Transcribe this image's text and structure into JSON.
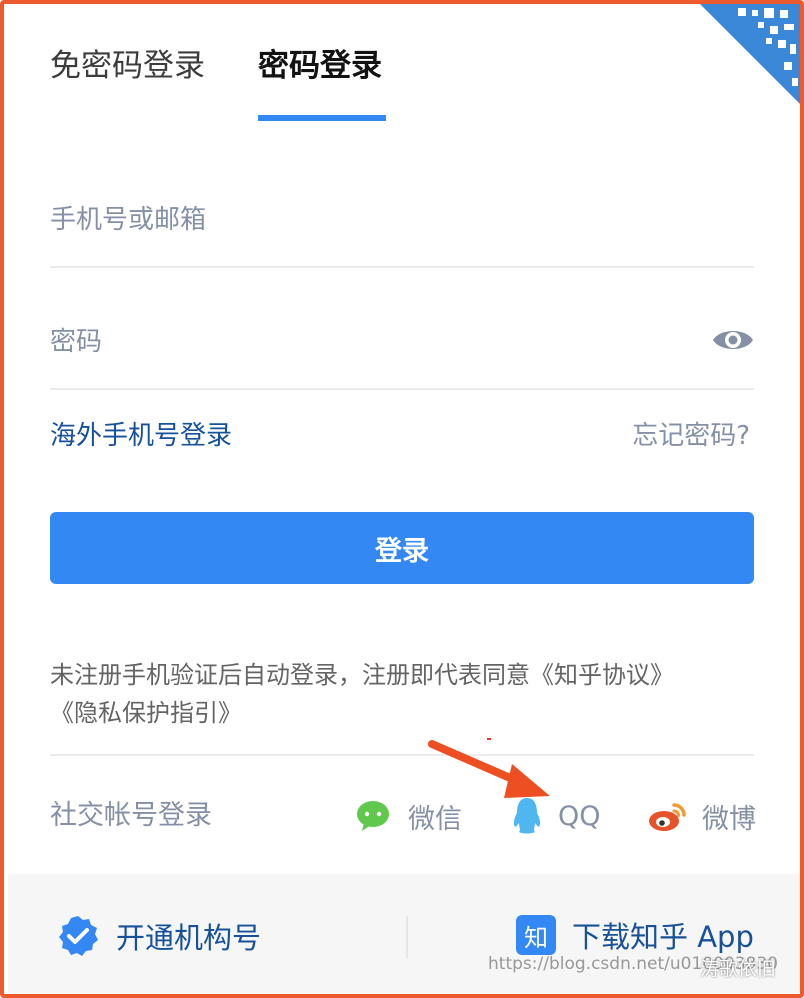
{
  "tabs": {
    "sms_login": "免密码登录",
    "password_login": "密码登录"
  },
  "form": {
    "account_placeholder": "手机号或邮箱",
    "password_placeholder": "密码",
    "overseas_link": "海外手机号登录",
    "forgot_link": "忘记密码?",
    "login_button": "登录"
  },
  "agreement": {
    "line1": "未注册手机验证后自动登录，注册即代表同意《知乎协议》",
    "line2": "《隐私保护指引》"
  },
  "social": {
    "label": "社交帐号登录",
    "wechat": "微信",
    "qq": "QQ",
    "weibo": "微博"
  },
  "footer": {
    "org": "开通机构号",
    "app_badge": "知",
    "app": "下载知乎 App"
  },
  "watermark": {
    "url": "https://blog.csdn.net/u010003830",
    "account": "涛歌依旧"
  },
  "colors": {
    "accent": "#3388f4",
    "border": "#ed5a2e",
    "link": "#175199",
    "muted": "#8590a6"
  }
}
